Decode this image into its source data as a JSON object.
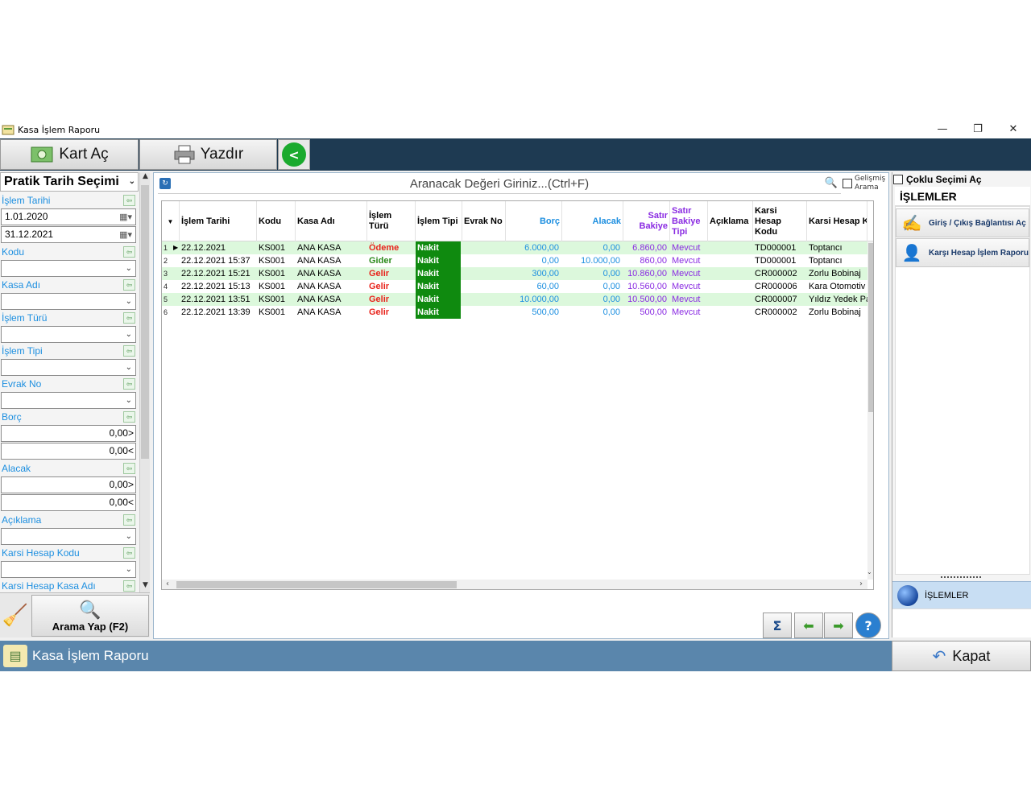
{
  "window": {
    "title": "Kasa İşlem Raporu",
    "controls": {
      "minimize": "—",
      "restore": "❐",
      "close": "✕"
    }
  },
  "toolbar": {
    "open_card_label": "Kart Aç",
    "print_label": "Yazdır",
    "share_icon": "share-icon"
  },
  "filters": {
    "quick_date_label": "Pratik Tarih Seçimi",
    "fields": [
      {
        "label": "İşlem Tarihi"
      },
      {
        "label": "Kodu"
      },
      {
        "label": "Kasa Adı"
      },
      {
        "label": "İşlem Türü"
      },
      {
        "label": "İşlem Tipi"
      },
      {
        "label": "Evrak No"
      },
      {
        "label": "Borç"
      },
      {
        "label": "Alacak"
      },
      {
        "label": "Açıklama"
      },
      {
        "label": "Karsi Hesap Kodu"
      },
      {
        "label": "Karsi Hesap Kasa Adı"
      }
    ],
    "date_from": "1.01.2020",
    "date_to": "31.12.2021",
    "borc_gt": "0,00>",
    "borc_lt": "0,00<",
    "alacak_gt": "0,00>",
    "alacak_lt": "0,00<",
    "search_button_label": "Arama Yap (F2)"
  },
  "search": {
    "placeholder": "Aranacak Değeri Giriniz...(Ctrl+F)",
    "advanced_label_1": "Gelişmiş",
    "advanced_label_2": "Arama"
  },
  "grid": {
    "headers": {
      "islem_tarihi": "İşlem Tarihi",
      "kodu": "Kodu",
      "kasa_adi": "Kasa Adı",
      "islem_turu": "İşlem Türü",
      "islem_tipi": "İşlem Tipi",
      "evrak_no": "Evrak No",
      "borc": "Borç",
      "alacak": "Alacak",
      "satir_bakiye": "Satır Bakiye",
      "satir_bakiye_tipi": "Satır Bakiye Tipi",
      "aciklama": "Açıklama",
      "karsi_hesap_kodu": "Karsi Hesap Kodu",
      "karsi_hesap_kasa": "Karsi Hesap Kas"
    },
    "rows": [
      {
        "no": "1",
        "tarih": "22.12.2021",
        "kodu": "KS001",
        "kasa": "ANA KASA",
        "tur": "Ödeme",
        "tip": "Nakit",
        "evrak": "",
        "borc": "6.000,00",
        "alacak": "0,00",
        "bakiye": "6.860,00",
        "bakiye_tipi": "Mevcut",
        "aciklama": "",
        "kh_kodu": "TD000001",
        "kh_kasa": "Toptancı"
      },
      {
        "no": "2",
        "tarih": "22.12.2021 15:37",
        "kodu": "KS001",
        "kasa": "ANA KASA",
        "tur": "Gider",
        "tip": "Nakit",
        "evrak": "",
        "borc": "0,00",
        "alacak": "10.000,00",
        "bakiye": "860,00",
        "bakiye_tipi": "Mevcut",
        "aciklama": "",
        "kh_kodu": "TD000001",
        "kh_kasa": "Toptancı"
      },
      {
        "no": "3",
        "tarih": "22.12.2021 15:21",
        "kodu": "KS001",
        "kasa": "ANA KASA",
        "tur": "Gelir",
        "tip": "Nakit",
        "evrak": "",
        "borc": "300,00",
        "alacak": "0,00",
        "bakiye": "10.860,00",
        "bakiye_tipi": "Mevcut",
        "aciklama": "",
        "kh_kodu": "CR000002",
        "kh_kasa": "Zorlu Bobinaj"
      },
      {
        "no": "4",
        "tarih": "22.12.2021 15:13",
        "kodu": "KS001",
        "kasa": "ANA KASA",
        "tur": "Gelir",
        "tip": "Nakit",
        "evrak": "",
        "borc": "60,00",
        "alacak": "0,00",
        "bakiye": "10.560,00",
        "bakiye_tipi": "Mevcut",
        "aciklama": "",
        "kh_kodu": "CR000006",
        "kh_kasa": "Kara Otomotiv"
      },
      {
        "no": "5",
        "tarih": "22.12.2021 13:51",
        "kodu": "KS001",
        "kasa": "ANA KASA",
        "tur": "Gelir",
        "tip": "Nakit",
        "evrak": "",
        "borc": "10.000,00",
        "alacak": "0,00",
        "bakiye": "10.500,00",
        "bakiye_tipi": "Mevcut",
        "aciklama": "",
        "kh_kodu": "CR000007",
        "kh_kasa": "Yıldız Yedek Pa"
      },
      {
        "no": "6",
        "tarih": "22.12.2021 13:39",
        "kodu": "KS001",
        "kasa": "ANA KASA",
        "tur": "Gelir",
        "tip": "Nakit",
        "evrak": "",
        "borc": "500,00",
        "alacak": "0,00",
        "bakiye": "500,00",
        "bakiye_tipi": "Mevcut",
        "aciklama": "",
        "kh_kodu": "CR000002",
        "kh_kasa": "Zorlu Bobinaj"
      }
    ]
  },
  "right_panel": {
    "multi_select_label": "Çoklu Seçimi Aç",
    "section_title": "İŞLEMLER",
    "actions": [
      {
        "label": "Giriş / Çıkış Bağlantısı Aç"
      },
      {
        "label": "Karşı Hesap İşlem Raporu"
      }
    ],
    "nav_selected": "İŞLEMLER"
  },
  "status": {
    "title": "Kasa İşlem Raporu",
    "close_label": "Kapat"
  },
  "colors": {
    "toolbar_bg": "#1e3a52",
    "status_bg": "#5a86ac",
    "row_highlight": "#dcf8dc",
    "nakit_bg": "#0f8a0f",
    "accent_blue": "#1d8fe0",
    "accent_purple": "#8a2be2"
  }
}
